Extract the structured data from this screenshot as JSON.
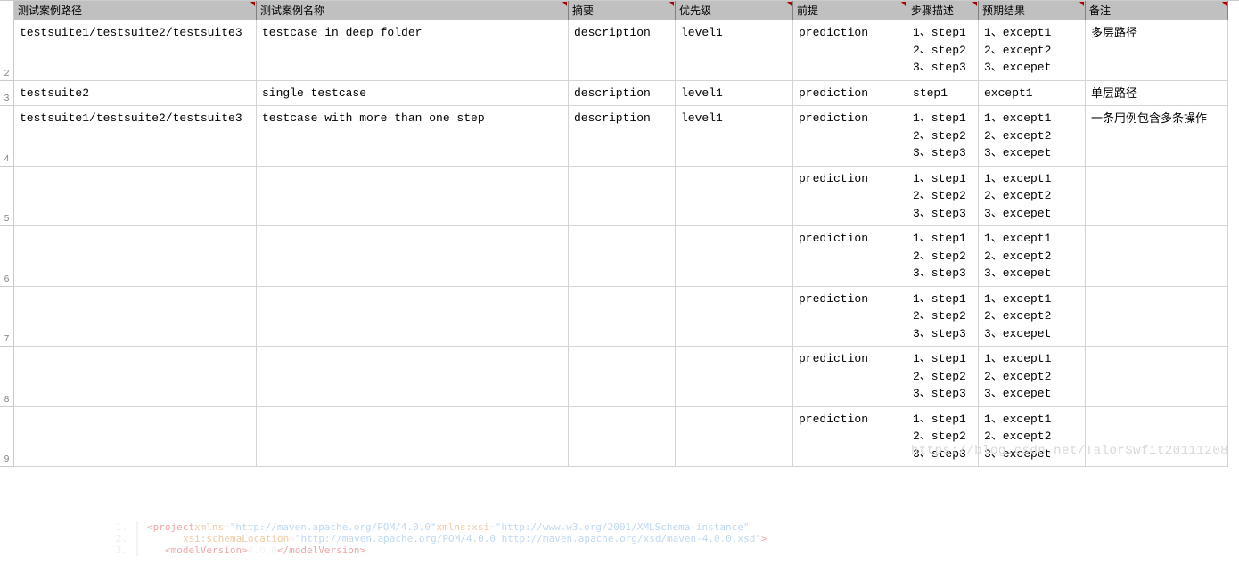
{
  "headers": [
    "测试案例路径",
    "测试案例名称",
    "摘要",
    "优先级",
    "前提",
    "步骤描述",
    "预期结果",
    "备注"
  ],
  "row_numbers": [
    "",
    "2",
    "3",
    "4",
    "5",
    "6",
    "7",
    "8",
    "9"
  ],
  "rows": [
    {
      "path": "testsuite1/testsuite2/testsuite3",
      "name": "testcase in deep folder",
      "summary": "description",
      "priority": "level1",
      "pre": "prediction",
      "steps": "1、step1\n2、step2\n3、step3",
      "expect": "1、except1\n2、except2\n3、excepet",
      "note": "多层路径"
    },
    {
      "path": "testsuite2",
      "name": "single testcase",
      "summary": "description",
      "priority": "level1",
      "pre": "prediction",
      "steps": "step1",
      "expect": "except1",
      "note": "单层路径"
    },
    {
      "path": "testsuite1/testsuite2/testsuite3",
      "name": "testcase with more than one step",
      "summary": "description",
      "priority": "level1",
      "pre": "prediction",
      "steps": "1、step1\n2、step2\n3、step3",
      "expect": "1、except1\n2、except2\n3、excepet",
      "note": "一条用例包含多条操作"
    },
    {
      "path": "",
      "name": "",
      "summary": "",
      "priority": "",
      "pre": "prediction",
      "steps": "1、step1\n2、step2\n3、step3",
      "expect": "1、except1\n2、except2\n3、excepet",
      "note": ""
    },
    {
      "path": "",
      "name": "",
      "summary": "",
      "priority": "",
      "pre": "prediction",
      "steps": "1、step1\n2、step2\n3、step3",
      "expect": "1、except1\n2、except2\n3、excepet",
      "note": ""
    },
    {
      "path": "",
      "name": "",
      "summary": "",
      "priority": "",
      "pre": "prediction",
      "steps": "1、step1\n2、step2\n3、step3",
      "expect": "1、except1\n2、except2\n3、excepet",
      "note": ""
    },
    {
      "path": "",
      "name": "",
      "summary": "",
      "priority": "",
      "pre": "prediction",
      "steps": "1、step1\n2、step2\n3、step3",
      "expect": "1、except1\n2、except2\n3、excepet",
      "note": ""
    },
    {
      "path": "",
      "name": "",
      "summary": "",
      "priority": "",
      "pre": "prediction",
      "steps": "1、step1\n2、step2\n3、step3",
      "expect": "1、except1\n2、except2\n3、excepet",
      "note": ""
    }
  ],
  "code": {
    "l1a": "<project ",
    "l1b": "xmlns",
    "l1c": "=",
    "l1d": "\"http://maven.apache.org/POM/4.0.0\"",
    "l1e": " xmlns:xsi",
    "l1f": "=",
    "l1g": "\"http://www.w3.org/2001/XMLSchema-instance\"",
    "l2a": "xsi:schemaLocation",
    "l2b": "=",
    "l2c": "\"http://maven.apache.org/POM/4.0.0 http://maven.apache.org/xsd/maven-4.0.0.xsd\"",
    "l2d": ">",
    "l3a": "<modelVersion>",
    "l3b": "4.0.0",
    "l3c": "</modelVersion>"
  },
  "watermark": "https://blog.csdn.net/TalorSwfit20111208"
}
